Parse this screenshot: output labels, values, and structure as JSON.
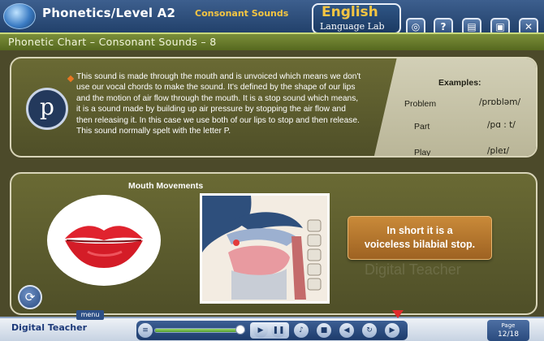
{
  "header": {
    "title": "Phonetics/Level A2",
    "topic": "Consonant Sounds",
    "brand_line1": "English",
    "brand_line2": "Language Lab"
  },
  "heading": "Phonetic Chart – Consonant Sounds – 8",
  "sound": {
    "symbol": "p",
    "description": "This sound is made through the mouth and is unvoiced which means we don't use our vocal chords to make the sound. It's defined by the shape of our lips and the motion of air flow through the mouth. It is a stop sound which means, it is a sound made by building up air pressure by stopping the air flow and then releasing it. In this case we use both of our lips to stop and then release. This sound normally spelt with the letter P."
  },
  "examples": {
    "title": "Examples:",
    "items": [
      {
        "word": "Problem",
        "ipa": "/prɒbləm/"
      },
      {
        "word": "Part",
        "ipa": "/pɑ : t/"
      },
      {
        "word": "Play",
        "ipa": "/pleɪ/"
      }
    ]
  },
  "mouth_movements": {
    "title": "Mouth Movements",
    "summary_line1": "In short it is a",
    "summary_line2": "voiceless bilabial stop."
  },
  "footer": {
    "logo": "Digital Teacher",
    "menu_label": "menu",
    "page_label": "Page",
    "page_value": "12/18",
    "progress": 0.95
  },
  "colors": {
    "accent_orange": "#e87722",
    "brand_yellow": "#f4c542",
    "panel_olive": "#5c5c2e"
  }
}
